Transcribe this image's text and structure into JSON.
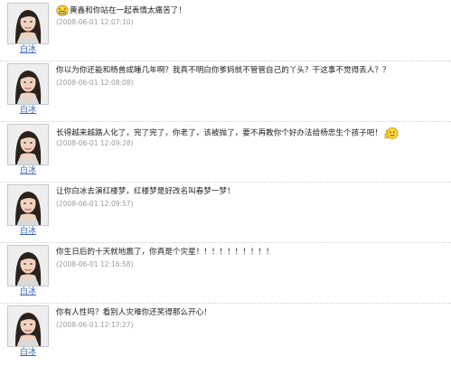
{
  "comments": [
    {
      "author": "白冰",
      "text": "黄鑫和你站在一起表情太痛苦了！",
      "time": "(2008-06-01 12:07:10)",
      "emoji_icon": "grimace-face-icon",
      "emoji_position": "lead"
    },
    {
      "author": "白冰",
      "text": "你以为你还能和杨兽成睡几年啊？我真不明白你爹妈就不管管自己的丫头？干这事不觉得丢人？？",
      "time": "(2008-06-01 12:08:08)"
    },
    {
      "author": "白冰",
      "text": "长得越来越路人化了，完了完了，你老了，该被抛了，要不再教你个好办法给杨忠生个孩子吧！",
      "time": "(2008-06-01 12:09:28)",
      "emoji_icon": "thumbs-up-face-icon",
      "emoji_position": "trail"
    },
    {
      "author": "白冰",
      "text": "让你白冰去演红楼梦，红楼梦是好改名叫春梦一梦！",
      "time": "(2008-06-01 12:09:57)"
    },
    {
      "author": "白冰",
      "text": "你生日后的十天就地震了，你真是个灾星！！！！！！！！！！",
      "time": "(2008-06-01 12:16:58)"
    },
    {
      "author": "白冰",
      "text": "你有人性吗？看别人灾难你还笑得那么开心！",
      "time": "(2008-06-01 12:17:27)"
    }
  ],
  "colors": {
    "author_link": "#3a63b8",
    "time_text": "#9a9a9a",
    "body_text": "#222222",
    "divider": "#d0d0d0"
  }
}
